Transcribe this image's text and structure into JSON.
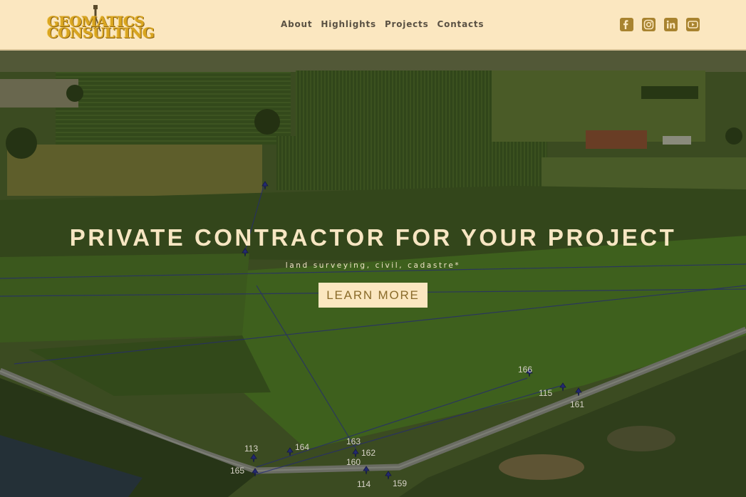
{
  "header": {
    "logo": {
      "line1": "GEOMATICS",
      "line2": "CONSULTING"
    },
    "nav": [
      {
        "label": "About"
      },
      {
        "label": "Highlights"
      },
      {
        "label": "Projects"
      },
      {
        "label": "Contacts"
      }
    ],
    "social": [
      {
        "icon": "facebook-icon"
      },
      {
        "icon": "instagram-icon"
      },
      {
        "icon": "linkedin-icon"
      },
      {
        "icon": "youtube-icon"
      }
    ]
  },
  "hero": {
    "title": "PRIVATE CONTRACTOR FOR YOUR PROJECT",
    "subtitle": "land surveying, civil, cadastre*",
    "cta_label": "LEARN MORE"
  },
  "map_markers": [
    {
      "label": "166"
    },
    {
      "label": "115"
    },
    {
      "label": "161"
    },
    {
      "label": "163"
    },
    {
      "label": "162"
    },
    {
      "label": "160"
    },
    {
      "label": "164"
    },
    {
      "label": "113"
    },
    {
      "label": "165"
    },
    {
      "label": "114"
    },
    {
      "label": "159"
    }
  ],
  "colors": {
    "header_bg": "#fbe7c0",
    "accent_gold": "#a8832f",
    "hero_text": "#f7e6c2",
    "marker": "#2a2f9a"
  }
}
